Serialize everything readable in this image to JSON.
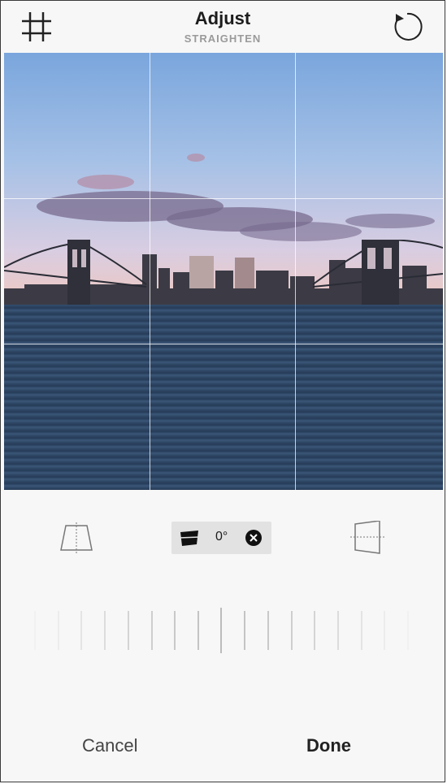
{
  "header": {
    "title": "Adjust",
    "subtitle": "STRAIGHTEN"
  },
  "icons": {
    "left": "grid-icon",
    "right": "reset-rotate-icon"
  },
  "tools": {
    "straighten_value": "0°"
  },
  "footer": {
    "cancel_label": "Cancel",
    "done_label": "Done"
  },
  "colors": {
    "background": "#f7f7f7",
    "text": "#1c1c1c",
    "subtitle": "#9a9a9a"
  }
}
